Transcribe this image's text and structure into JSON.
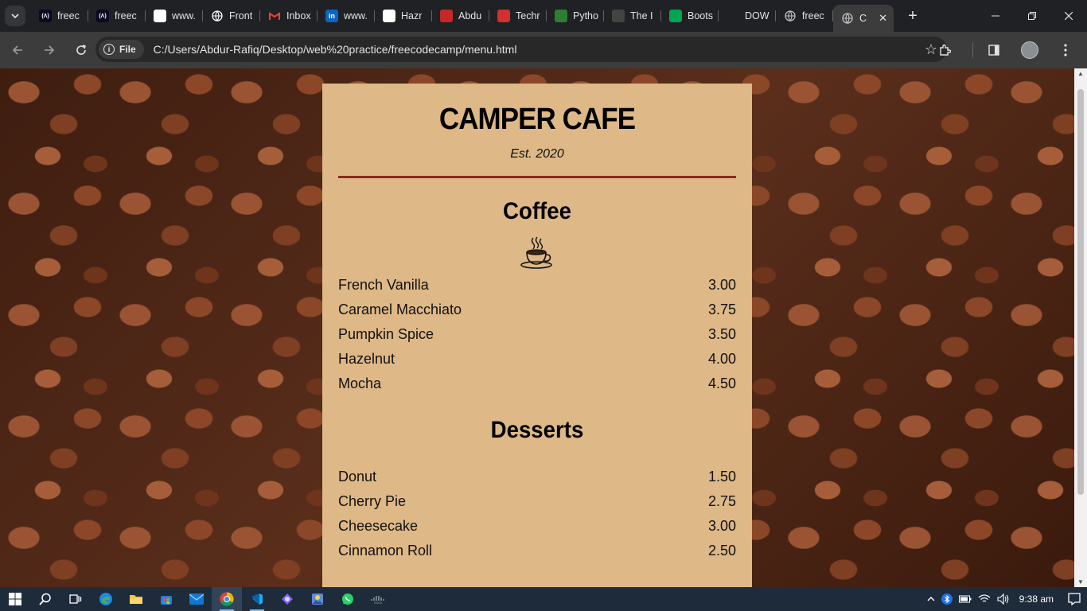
{
  "browser": {
    "tabs": [
      {
        "title": "freec",
        "icon": "freecodecamp-icon",
        "color": "#0a0a23"
      },
      {
        "title": "freec",
        "icon": "freecodecamp-icon",
        "color": "#0a0a23"
      },
      {
        "title": "www.",
        "icon": "page-icon",
        "color": "#ffffff"
      },
      {
        "title": "Front",
        "icon": "globe-icon",
        "color": "#ffffff"
      },
      {
        "title": "Inbox",
        "icon": "gmail-icon",
        "color": "#ea4335"
      },
      {
        "title": "www.",
        "icon": "linkedin-icon",
        "color": "#0a66c2"
      },
      {
        "title": "Hazr",
        "icon": "page-icon",
        "color": "#ffffff"
      },
      {
        "title": "Abdu",
        "icon": "page-icon",
        "color": "#c62828"
      },
      {
        "title": "Techr",
        "icon": "page-icon",
        "color": "#d32f2f"
      },
      {
        "title": "Pytho",
        "icon": "page-icon",
        "color": "#2e7d32"
      },
      {
        "title": "The I",
        "icon": "page-icon",
        "color": "#444444"
      },
      {
        "title": "Boots",
        "icon": "page-icon",
        "color": "#00a651"
      },
      {
        "title": "DOW",
        "icon": "blank-icon",
        "color": "#202124"
      },
      {
        "title": "freec",
        "icon": "globe-icon",
        "color": "#bdc1c6"
      },
      {
        "title": "C",
        "icon": "globe-icon",
        "color": "#bdc1c6",
        "active": true
      }
    ],
    "url_chip": "File",
    "url": "C:/Users/Abdur-Rafiq/Desktop/web%20practice/freecodecamp/menu.html"
  },
  "menu": {
    "title": "CAMPER CAFE",
    "established": "Est. 2020",
    "coffee": {
      "heading": "Coffee",
      "items": [
        {
          "name": "French Vanilla",
          "price": "3.00"
        },
        {
          "name": "Caramel Macchiato",
          "price": "3.75"
        },
        {
          "name": "Pumpkin Spice",
          "price": "3.50"
        },
        {
          "name": "Hazelnut",
          "price": "4.00"
        },
        {
          "name": "Mocha",
          "price": "4.50"
        }
      ]
    },
    "desserts": {
      "heading": "Desserts",
      "items": [
        {
          "name": "Donut",
          "price": "1.50"
        },
        {
          "name": "Cherry Pie",
          "price": "2.75"
        },
        {
          "name": "Cheesecake",
          "price": "3.00"
        },
        {
          "name": "Cinnamon Roll",
          "price": "2.50"
        }
      ]
    },
    "colors": {
      "card": "#deb887",
      "divider": "#8b2b1b"
    }
  },
  "taskbar": {
    "apps": [
      "windows-start-icon",
      "search-icon",
      "task-view-icon",
      "edge-icon",
      "file-explorer-icon",
      "store-icon",
      "mail-icon",
      "chrome-icon",
      "vscode-icon",
      "copilot-icon",
      "photos-icon",
      "whatsapp-icon",
      "cisco-icon"
    ],
    "time": "9:38 am"
  }
}
